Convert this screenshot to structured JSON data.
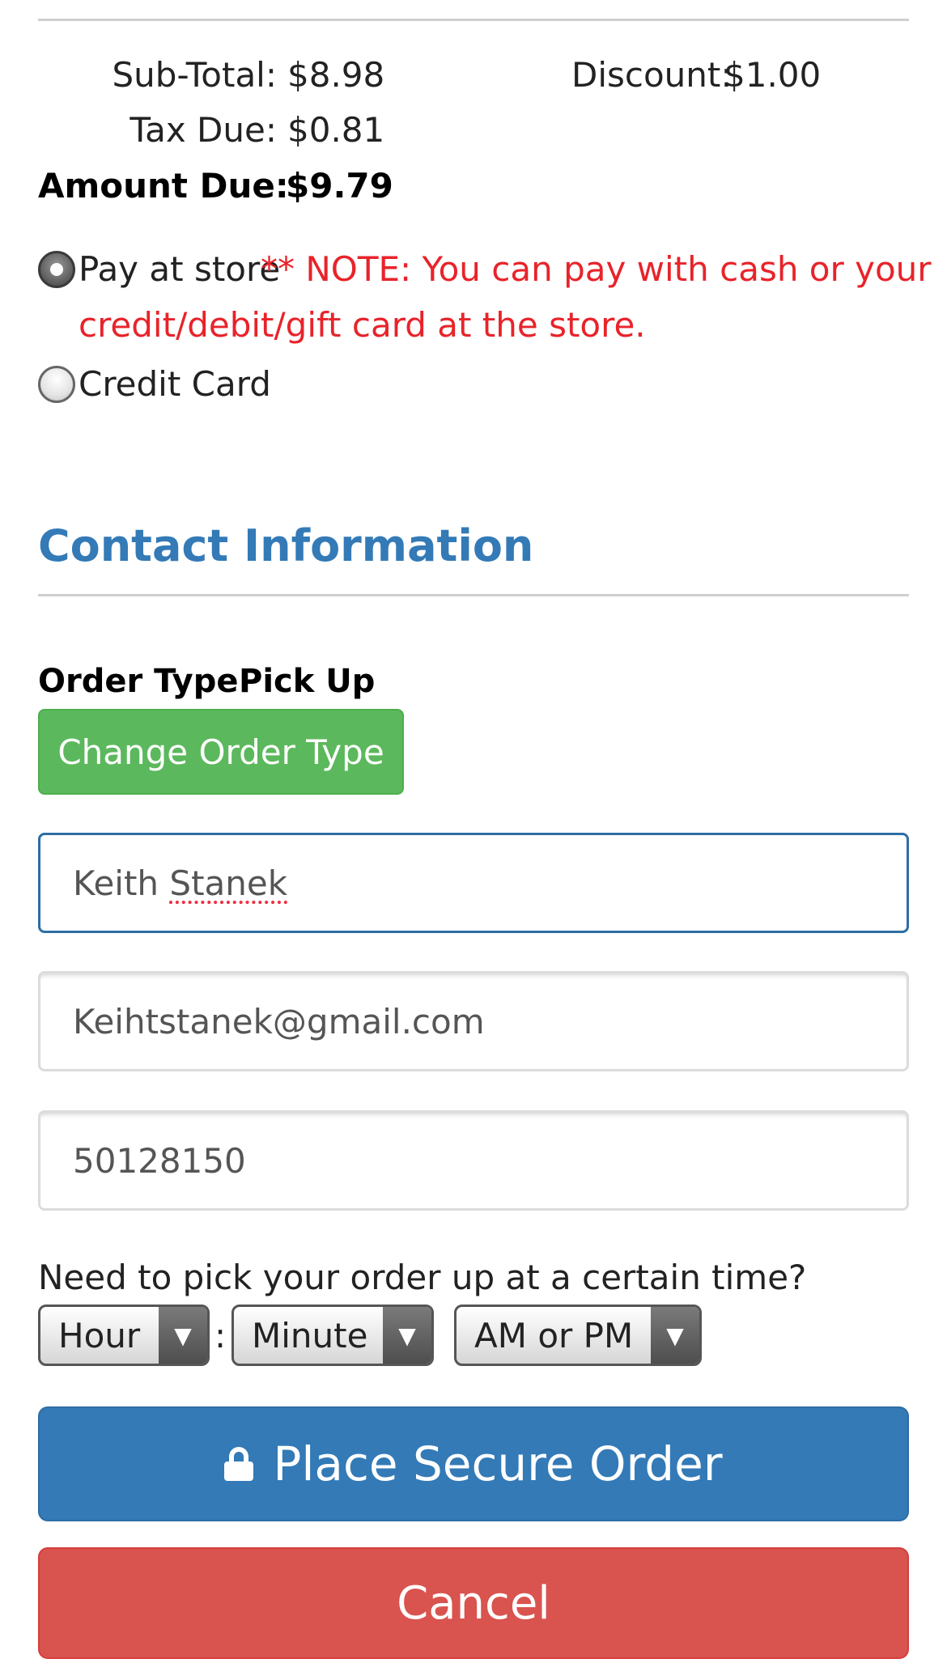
{
  "totals": {
    "subtotal_label": "Sub-Total:",
    "subtotal_value": "$8.98",
    "discount_label": "Discount:",
    "discount_value": "$1.00",
    "tax_label": "Tax Due:",
    "tax_value": "$0.81",
    "amount_due_label": "Amount Due:",
    "amount_due_value": "$9.79"
  },
  "payment": {
    "options": [
      {
        "label": "Pay at store",
        "selected": true
      },
      {
        "label": "Credit Card",
        "selected": false
      }
    ],
    "note_line1": "** NOTE: You can pay with cash or your",
    "note_line2": "credit/debit/gift card at the store."
  },
  "contact": {
    "heading": "Contact Information",
    "order_type_label": "Order Type:",
    "order_type_value": "Pick Up",
    "change_order_type_button": "Change Order Type",
    "name_first": "Keith",
    "name_last": "Stanek",
    "email_value": "Keihtstanek@gmail.com",
    "phone_value": "50128150"
  },
  "pickup_time": {
    "question": "Need to pick your order up at a certain time?",
    "hour_value": "Hour",
    "separator": ":",
    "minute_value": "Minute",
    "ampm_value": "AM or PM"
  },
  "actions": {
    "place_order": "Place Secure Order",
    "cancel": "Cancel"
  },
  "colors": {
    "brand_blue": "#337ab7",
    "success_green": "#5cb85c",
    "danger_red": "#d9534f",
    "note_red": "#e8232a"
  },
  "icons": {
    "lock": "lock-icon",
    "dropdown": "triangle-down-icon"
  }
}
